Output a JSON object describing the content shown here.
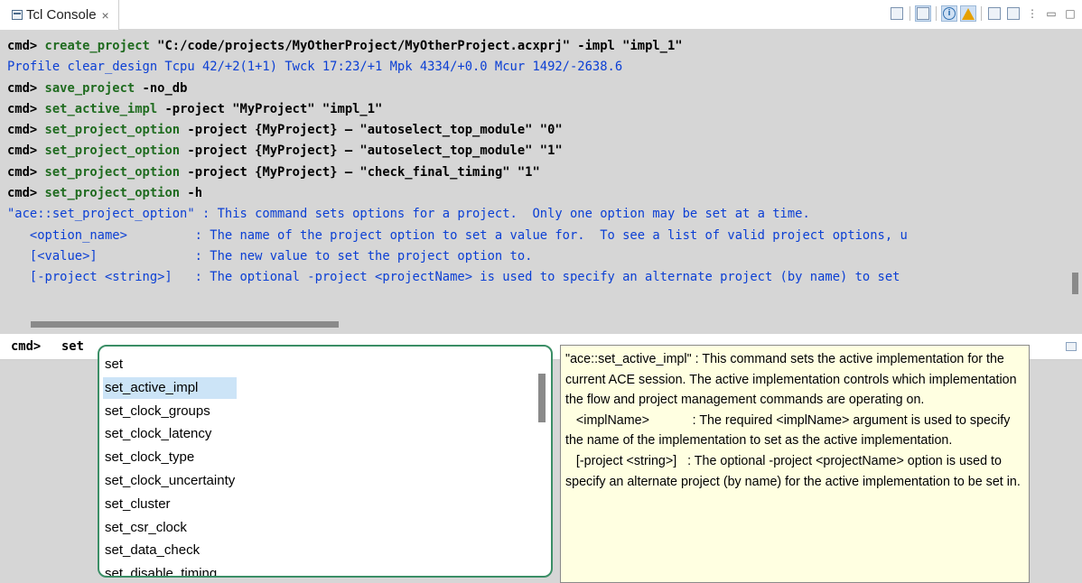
{
  "tab": {
    "title": "Tcl Console",
    "close": "×"
  },
  "console": {
    "lines": [
      {
        "kind": "cmd",
        "prompt": "cmd>",
        "name": "create_project",
        "args": " \"C:/code/projects/MyOtherProject/MyOtherProject.acxprj\" -impl \"impl_1\""
      },
      {
        "kind": "out",
        "text": "Profile clear_design Tcpu 42/+2(1+1) Twck 17:23/+1 Mpk 4334/+0.0 Mcur 1492/-2638.6"
      },
      {
        "kind": "cmd",
        "prompt": "cmd>",
        "name": "save_project",
        "args": " -no_db"
      },
      {
        "kind": "cmd",
        "prompt": "cmd>",
        "name": "set_active_impl",
        "args": " -project \"MyProject\" \"impl_1\""
      },
      {
        "kind": "cmd",
        "prompt": "cmd>",
        "name": "set_project_option",
        "args": " -project {MyProject} — \"autoselect_top_module\" \"0\""
      },
      {
        "kind": "cmd",
        "prompt": "cmd>",
        "name": "set_project_option",
        "args": " -project {MyProject} — \"autoselect_top_module\" \"1\""
      },
      {
        "kind": "cmd",
        "prompt": "cmd>",
        "name": "set_project_option",
        "args": " -project {MyProject} — \"check_final_timing\" \"1\""
      },
      {
        "kind": "cmd",
        "prompt": "cmd>",
        "name": "set_project_option",
        "args": " -h"
      },
      {
        "kind": "out",
        "text": "\"ace::set_project_option\" : This command sets options for a project.  Only one option may be set at a time."
      },
      {
        "kind": "out",
        "text": "   <option_name>         : The name of the project option to set a value for.  To see a list of valid project options, u"
      },
      {
        "kind": "out",
        "text": "   [<value>]             : The new value to set the project option to."
      },
      {
        "kind": "out",
        "text": "   [-project <string>]   : The optional -project <projectName> is used to specify an alternate project (by name) to set"
      }
    ]
  },
  "input": {
    "prompt": "cmd>",
    "value": "set"
  },
  "completions": {
    "items": [
      "set",
      "set_active_impl",
      "set_clock_groups",
      "set_clock_latency",
      "set_clock_type",
      "set_clock_uncertainty",
      "set_cluster",
      "set_csr_clock",
      "set_data_check",
      "set_disable_timing"
    ],
    "selected_index": 1
  },
  "tooltip": {
    "paragraphs": [
      "\"ace::set_active_impl\" : This command sets the active implementation for the current ACE session. The active implementation controls which implementation the flow and project management commands are operating on.",
      "   <implName>            : The required <implName> argument is used to specify the name of the implementation to set as the active implementation.",
      "   [-project <string>]   : The optional -project <projectName> option is used to specify an alternate project (by name) for the active implementation to be set in."
    ]
  },
  "colors": {
    "command": "#1f6b1f",
    "output": "#0b3fd4",
    "selection": "#cce4f7",
    "popup_border": "#3b8e66",
    "tooltip_bg": "#ffffe1"
  }
}
